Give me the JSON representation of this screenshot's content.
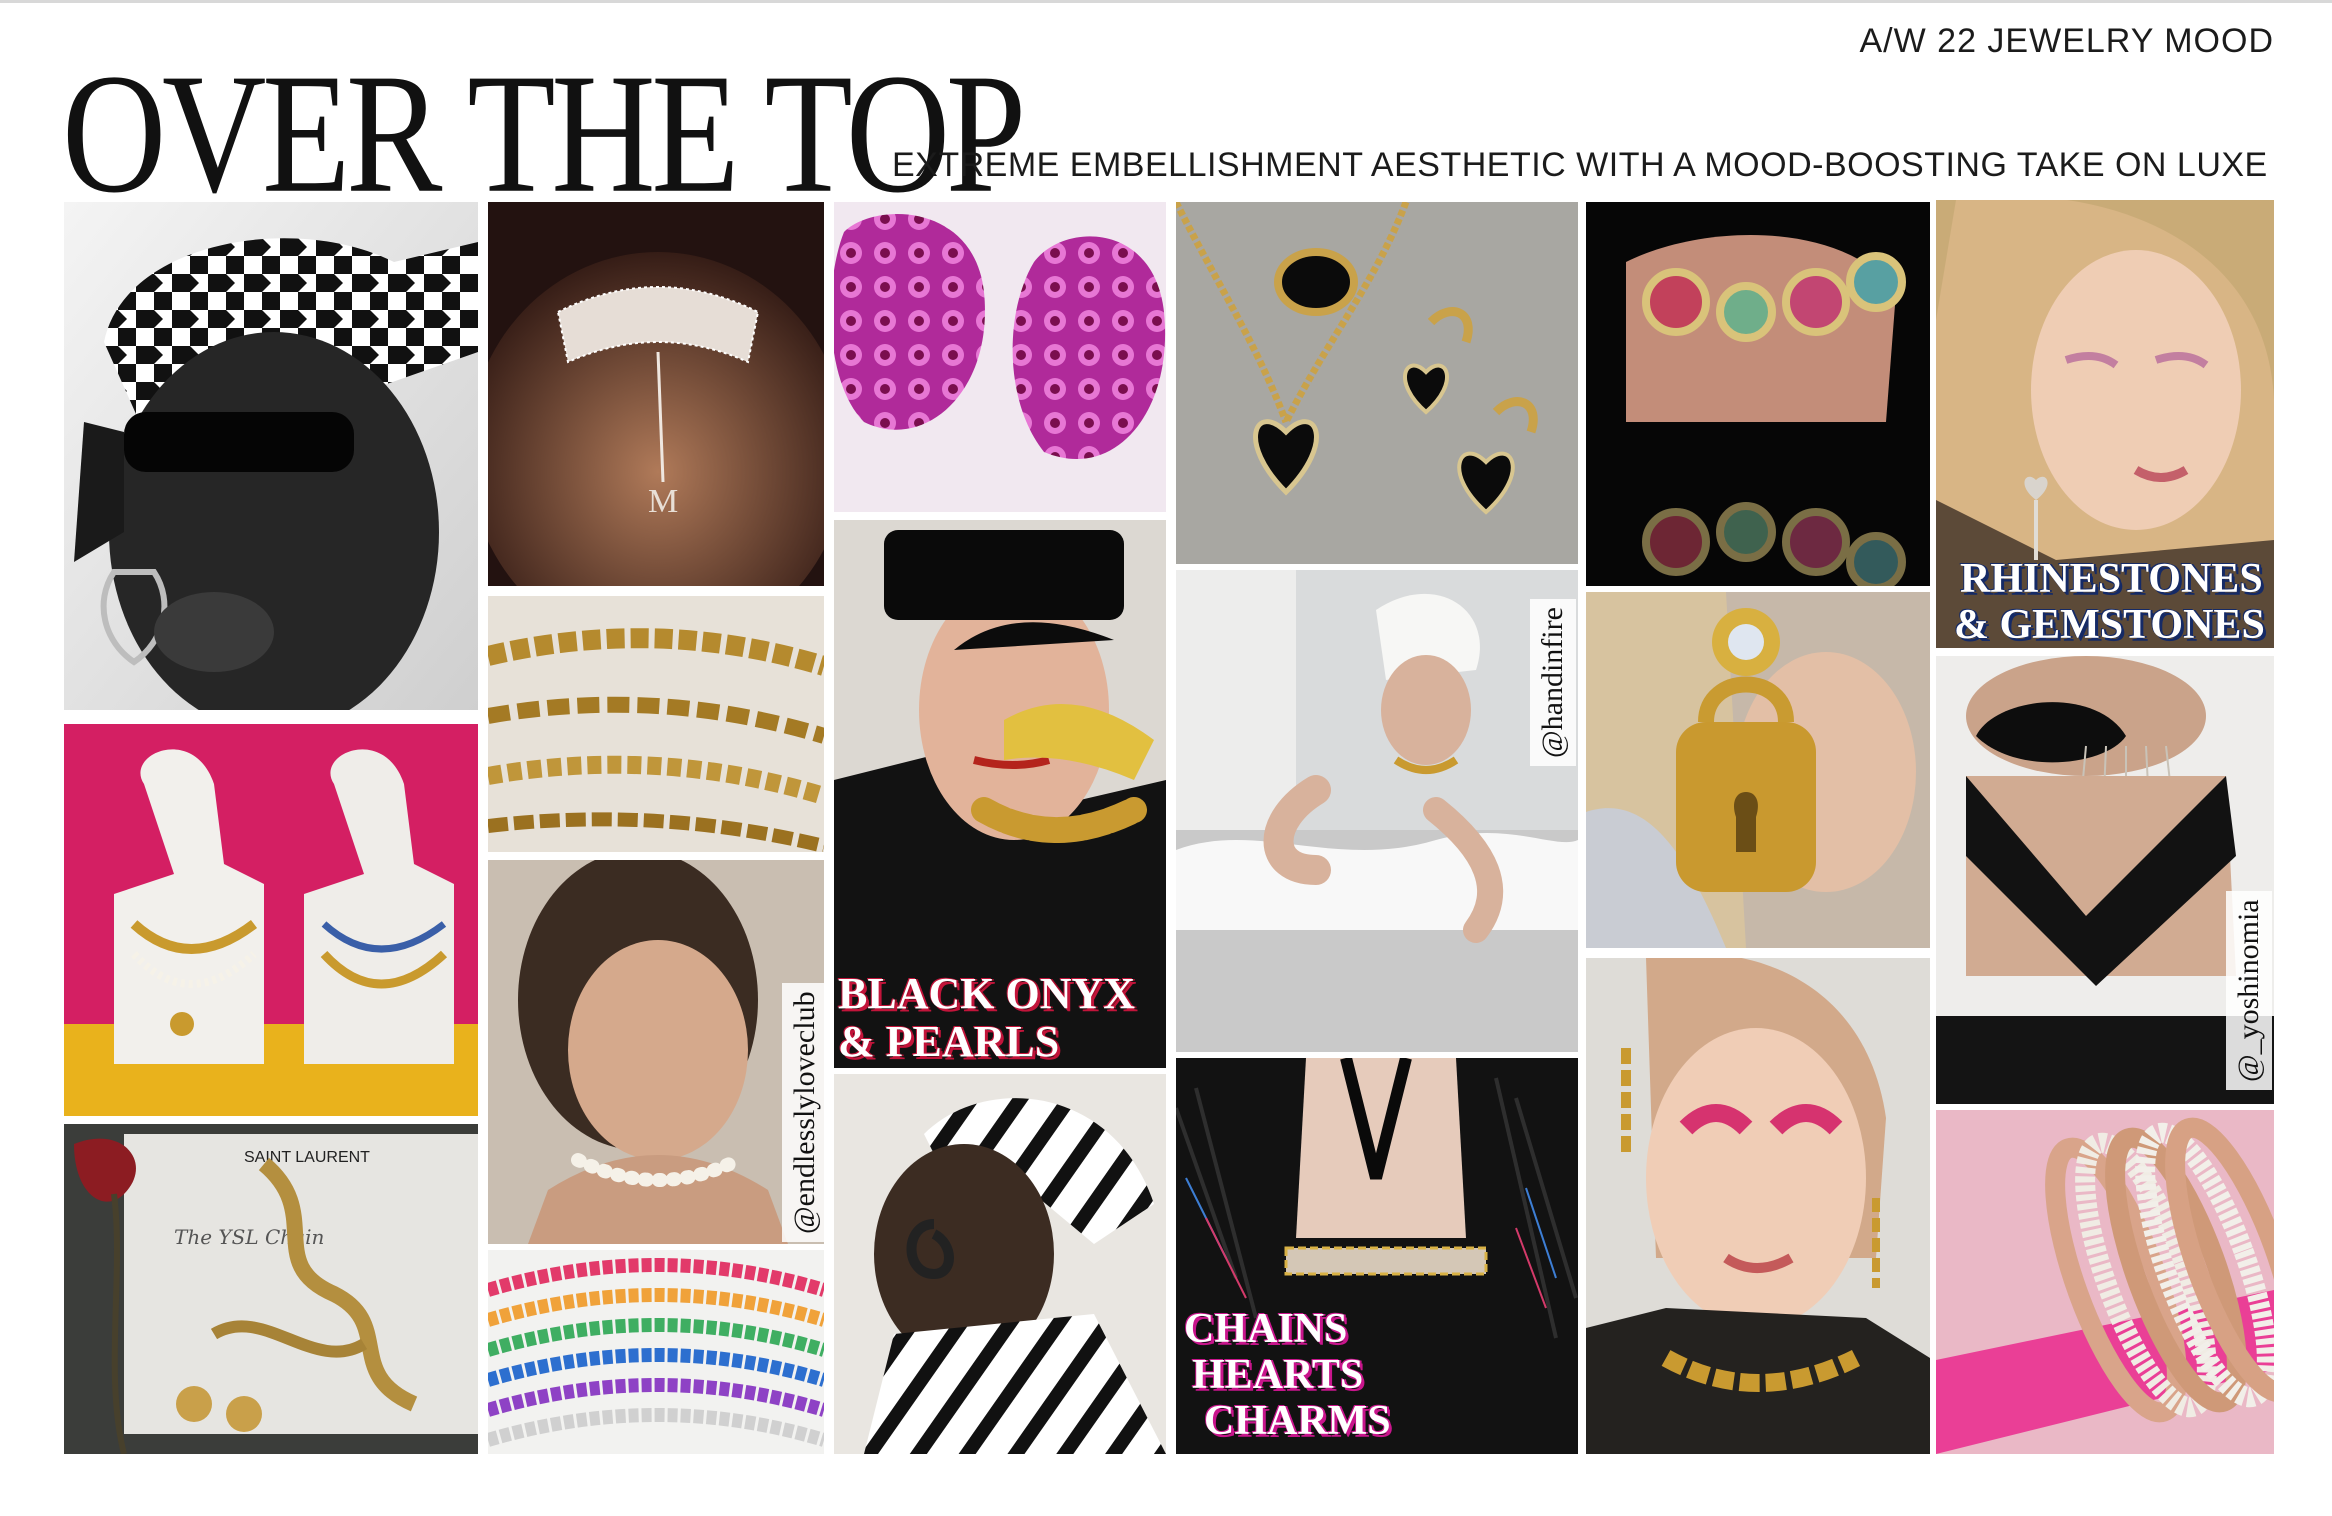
{
  "header": {
    "season": "A/W 22 JEWELRY MOOD",
    "title": "OVER THE TOP",
    "subtitle": "EXTREME EMBELLISHMENT AESTHETIC WITH A MOOD-BOOSTING TAKE ON LUXE"
  },
  "banners": {
    "rhinestones_line1": "RHINESTONES",
    "rhinestones_line2": "& GEMSTONES",
    "onyx_line1": "BLACK ONYX",
    "onyx_line2": "& PEARLS",
    "chains_line1": "CHAINS",
    "chains_line2": "HEARTS",
    "chains_line3": "CHARMS"
  },
  "handles": {
    "endlessly": "@endlesslyloveclub",
    "handinfire": "@handinfire",
    "yoshinomia": "@_yoshinomia"
  },
  "photo_text": {
    "box_brand": "SAINT LAURENT",
    "card_script": "The YSL Chain"
  },
  "colors": {
    "rhinestones_banner": "#152a66",
    "onyx_banner": "#c2143a",
    "chains_banner": "#c8158c"
  }
}
